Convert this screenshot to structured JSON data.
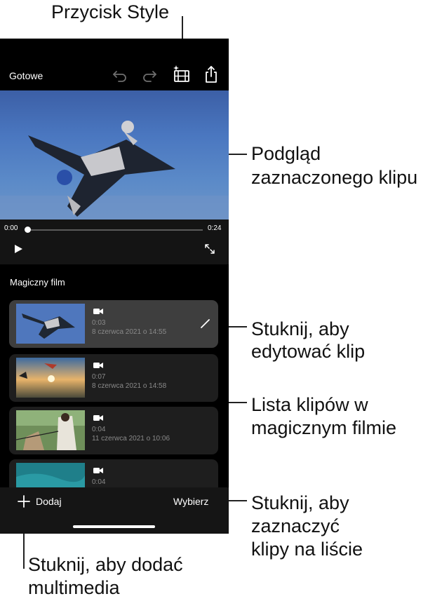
{
  "app": {
    "done_label": "Gotowe",
    "toolbar_icons": [
      "undo-icon",
      "redo-icon",
      "style-icon",
      "share-icon"
    ],
    "player": {
      "current_time": "0:00",
      "total_time": "0:24",
      "progress": 0
    },
    "section_title": "Magiczny film",
    "clips": [
      {
        "duration": "0:03",
        "date": "8 czerwca 2021 o 14:55",
        "selected": true
      },
      {
        "duration": "0:07",
        "date": "8 czerwca 2021 o 14:58",
        "selected": false
      },
      {
        "duration": "0:04",
        "date": "11 czerwca 2021 o 10:06",
        "selected": false
      },
      {
        "duration": "0:04",
        "date": "",
        "selected": false
      }
    ],
    "add_label": "Dodaj",
    "select_label": "Wybierz"
  },
  "callouts": {
    "style_button": "Przycisk Style",
    "preview_line1": "Podgląd",
    "preview_line2": "zaznaczonego klipu",
    "edit_line1": "Stuknij, aby",
    "edit_line2": "edytować klip",
    "list_line1": "Lista klipów w",
    "list_line2": "magicznym filmie",
    "select_line1": "Stuknij, aby",
    "select_line2": "zaznaczyć",
    "select_line3": "klipy na liście",
    "add_line1": "Stuknij, aby dodać",
    "add_line2": "multimedia"
  },
  "colors": {
    "background": "#000000",
    "selected_row": "#3e3e3e",
    "row": "#1e1e1e",
    "secondary_text": "#8a8a8a"
  }
}
